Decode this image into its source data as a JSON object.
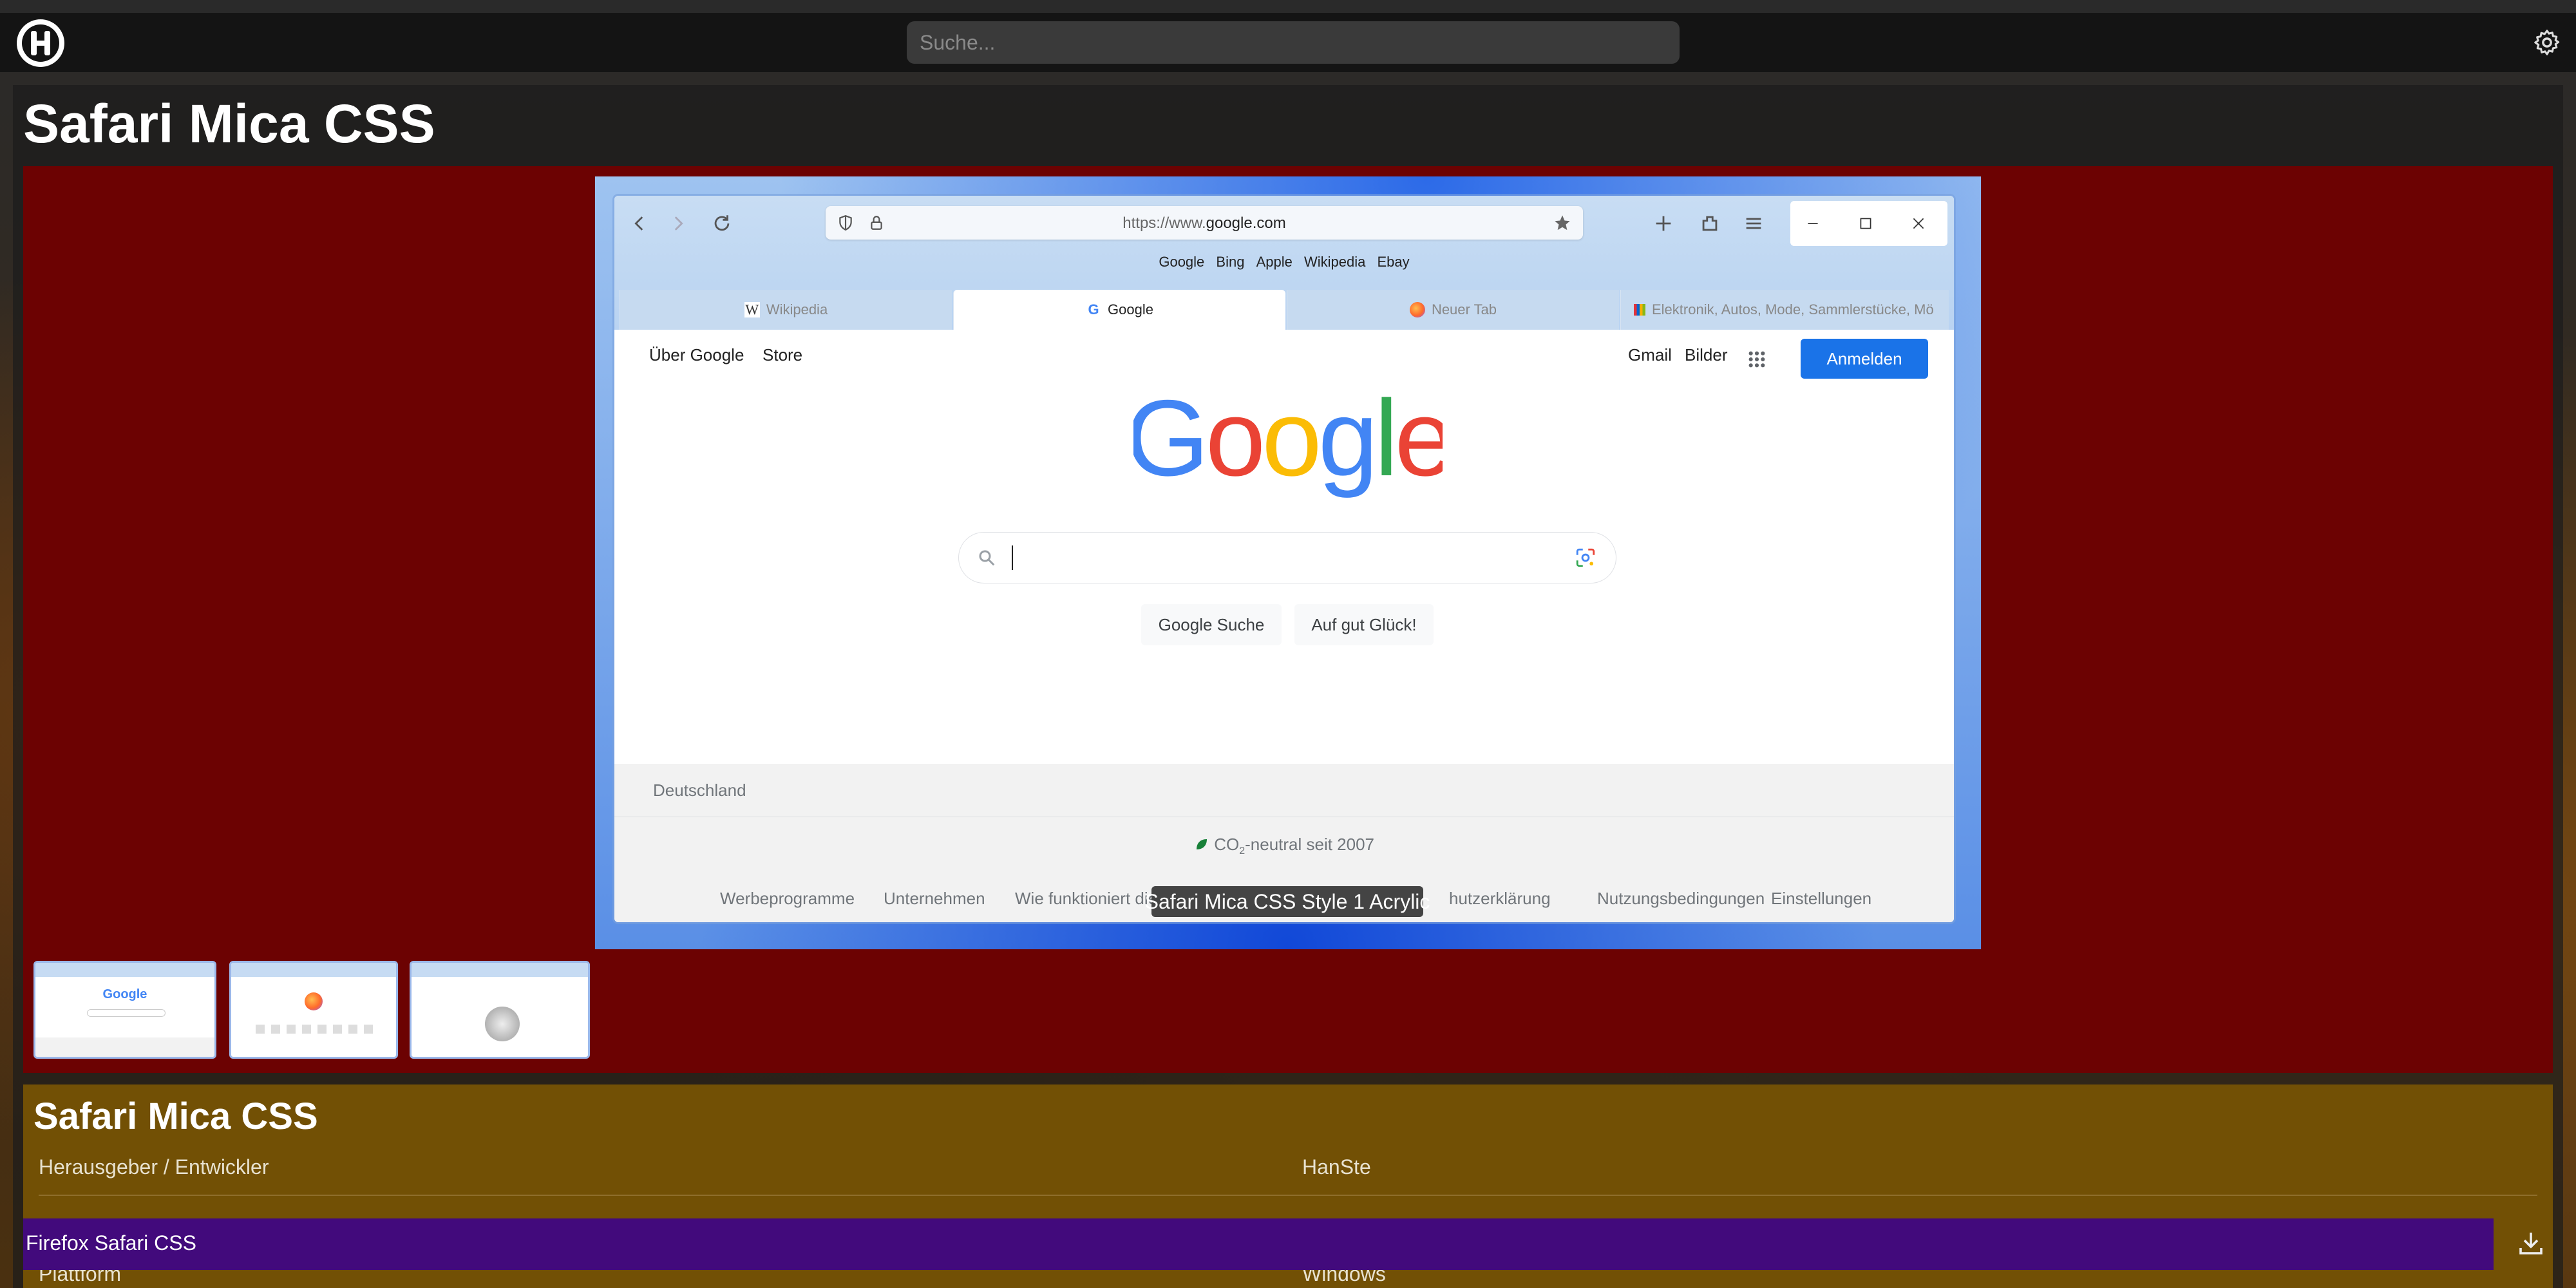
{
  "header": {
    "search_placeholder": "Suche...",
    "logo_icon": "h-logo-icon",
    "settings_icon": "gear-icon"
  },
  "page": {
    "title": "Safari Mica CSS"
  },
  "screenshot": {
    "url_prefix": "https://www.",
    "url_domain": "google.com",
    "bookmarks": [
      "Google",
      "Bing",
      "Apple",
      "Wikipedia",
      "Ebay"
    ],
    "tabs": [
      {
        "label": "Wikipedia",
        "active": false
      },
      {
        "label": "Google",
        "active": true
      },
      {
        "label": "Neuer Tab",
        "active": false
      },
      {
        "label": "Elektronik, Autos, Mode, Sammlerstücke, Mö",
        "active": false
      }
    ],
    "google": {
      "top_left": [
        "Über Google",
        "Store"
      ],
      "top_right": [
        "Gmail",
        "Bilder"
      ],
      "signin": "Anmelden",
      "btn_search": "Google Suche",
      "btn_lucky": "Auf gut Glück!",
      "country": "Deutschland",
      "co2": "CO",
      "co2_sub": "2",
      "co2_rest": "-neutral seit 2007",
      "footer_links": [
        "Werbeprogramme",
        "Unternehmen",
        "Wie funktioniert die",
        "hutzerklärung",
        "Nutzungsbedingungen",
        "Einstellungen"
      ]
    },
    "caption": "Safari Mica CSS Style 1 Acrylic"
  },
  "details": {
    "title": "Safari Mica CSS",
    "rows": [
      {
        "label": "Herausgeber / Entwickler",
        "value": "HanSte"
      },
      {
        "label": "Plattform",
        "value": "Windows"
      }
    ]
  },
  "download_bar": {
    "label": "Firefox Safari CSS"
  },
  "colors": {
    "gallery_bg": "#6c0202",
    "details_bg": "#725005",
    "download_bar_bg": "#420a7c",
    "signin_blue": "#1a73e8"
  }
}
